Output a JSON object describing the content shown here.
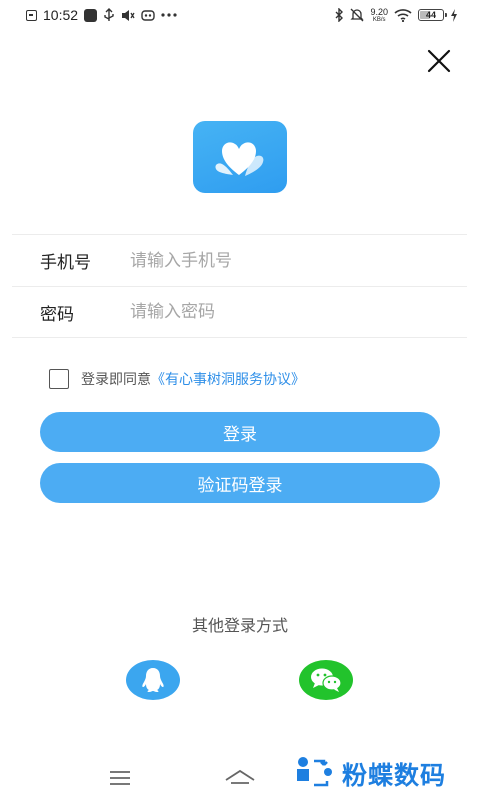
{
  "status_bar": {
    "time": "10:52",
    "net_speed": "9.20",
    "net_unit": "KB/s",
    "battery_level": "44",
    "battery_fraction": 0.44
  },
  "login_form": {
    "phone_label": "手机号",
    "phone_placeholder": "请输入手机号",
    "phone_value": "",
    "password_label": "密码",
    "password_placeholder": "请输入密码",
    "password_value": ""
  },
  "agreement": {
    "checked": false,
    "prefix": "登录即同意",
    "link_text": "《有心事树洞服务协议》"
  },
  "buttons": {
    "login_label": "登录",
    "sms_login_label": "验证码登录"
  },
  "other_login": {
    "title": "其他登录方式",
    "qq_icon": "qq-icon",
    "wechat_icon": "wechat-icon"
  },
  "colors": {
    "accent": "#4cacf3",
    "link": "#2f8fe8",
    "qq": "#3ba6ef",
    "wechat": "#22c32c",
    "watermark": "#1e7fe0"
  },
  "watermark": {
    "text": "粉蝶数码"
  }
}
